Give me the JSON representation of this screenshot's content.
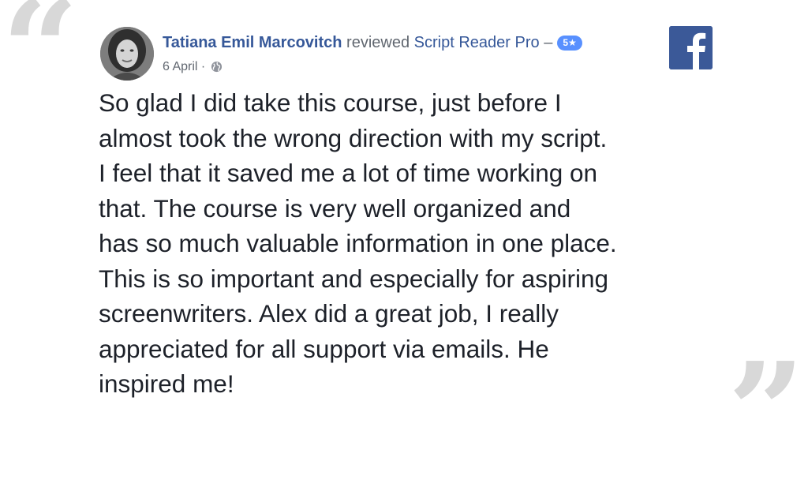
{
  "review": {
    "reviewer_name": "Tatiana Emil Marcovitch",
    "action_text": "reviewed",
    "page_name": "Script Reader Pro",
    "separator": "–",
    "rating": "5",
    "star_glyph": "★",
    "date": "6 April",
    "meta_separator": "·",
    "privacy_icon": "globe-icon",
    "body_lines": [
      "So glad I did take this course, just before I",
      "almost took the wrong direction with my script.",
      "I feel that it saved me a lot of time working on",
      "that. The course is very well organized and",
      "has so much valuable information in one place.",
      "This is so important and especially for aspiring",
      "screenwriters. Alex did a great job, I really",
      "appreciated for all support via emails. He",
      "inspired me!"
    ]
  },
  "decor": {
    "open_quote": "“",
    "close_quote": "”"
  },
  "brand": {
    "logo_icon": "facebook-logo-icon",
    "facebook_blue": "#3b5998",
    "link_color": "#365899",
    "badge_color": "#5890ff"
  }
}
